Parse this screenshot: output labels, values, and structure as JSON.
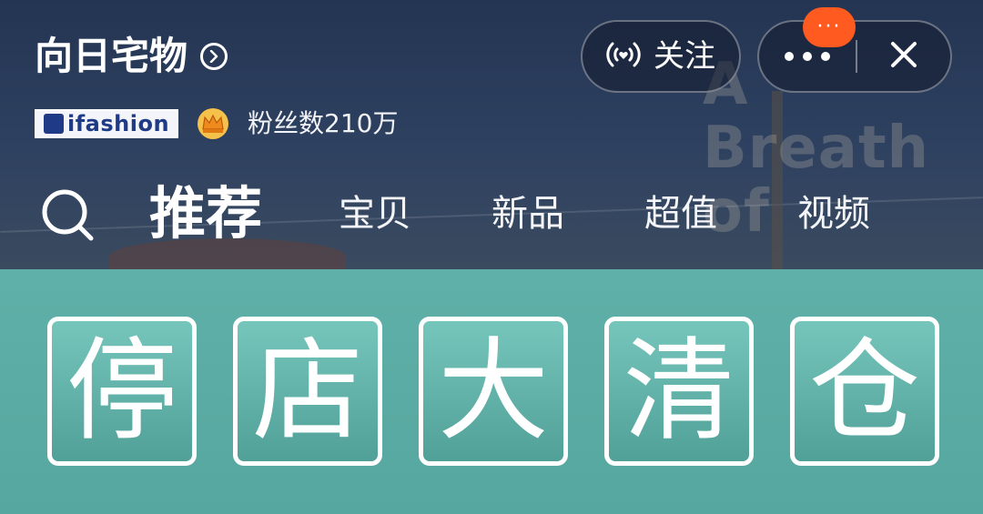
{
  "store": {
    "name": "向日宅物",
    "platform_badge": "ifashion",
    "fans_label": "粉丝数210万"
  },
  "header": {
    "follow_label": "关注",
    "more_badge": "···"
  },
  "tabs": [
    {
      "label": "推荐",
      "active": true
    },
    {
      "label": "宝贝",
      "active": false
    },
    {
      "label": "新品",
      "active": false
    },
    {
      "label": "超值",
      "active": false
    },
    {
      "label": "视频",
      "active": false
    }
  ],
  "background_text": "A Breath of",
  "banner": {
    "chars": [
      "停",
      "店",
      "大",
      "清",
      "仓"
    ]
  },
  "colors": {
    "header_bg": "#243553",
    "banner_bg": "#5fb0a8",
    "badge": "#ff5a1f",
    "ifashion_blue": "#1f3b87",
    "crown_gold": "#f0a020"
  },
  "icons": {
    "store_chevron": "chevron-right-circle-icon",
    "crown": "crown-icon",
    "live": "live-broadcast-icon",
    "more": "more-dots-icon",
    "close": "close-icon",
    "search": "search-icon"
  }
}
